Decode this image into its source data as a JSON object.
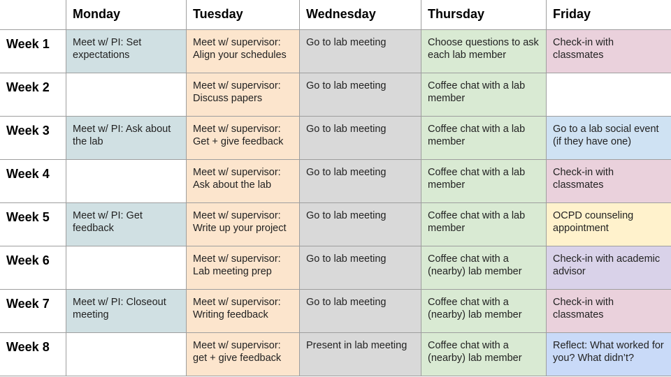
{
  "header": {
    "corner": "",
    "days": [
      "Monday",
      "Tuesday",
      "Wednesday",
      "Thursday",
      "Friday"
    ]
  },
  "colors": {
    "pi": "#d0e0e3",
    "supervisor": "#fce5cd",
    "lab_meeting": "#d9d9d9",
    "coffee": "#d9ead3",
    "classmates": "#ead1dc",
    "social": "#cfe2f3",
    "ocpd": "#fff2cc",
    "advisor": "#d9d2e9",
    "reflect": "#c9daf8"
  },
  "weeks": [
    {
      "label": "Week 1",
      "cells": [
        {
          "text": "Meet w/ PI: Set expectations",
          "cat": "pi"
        },
        {
          "text": "Meet w/ supervisor: Align your schedules",
          "cat": "sup"
        },
        {
          "text": "Go to lab meeting",
          "cat": "lab"
        },
        {
          "text": "Choose questions to ask each lab member",
          "cat": "coffee"
        },
        {
          "text": "Check-in with classmates",
          "cat": "class"
        }
      ]
    },
    {
      "label": "Week 2",
      "cells": [
        {
          "text": "",
          "cat": "empty"
        },
        {
          "text": "Meet w/ supervisor: Discuss papers",
          "cat": "sup"
        },
        {
          "text": "Go to lab meeting",
          "cat": "lab"
        },
        {
          "text": "Coffee chat with a lab member",
          "cat": "coffee"
        },
        {
          "text": "",
          "cat": "empty"
        }
      ]
    },
    {
      "label": "Week 3",
      "cells": [
        {
          "text": "Meet w/ PI: Ask about the lab",
          "cat": "pi"
        },
        {
          "text": "Meet w/ supervisor: Get + give feedback",
          "cat": "sup"
        },
        {
          "text": "Go to lab meeting",
          "cat": "lab"
        },
        {
          "text": "Coffee chat with a lab member",
          "cat": "coffee"
        },
        {
          "text": "Go to a lab social event (if they have one)",
          "cat": "social"
        }
      ]
    },
    {
      "label": "Week 4",
      "cells": [
        {
          "text": "",
          "cat": "empty"
        },
        {
          "text": "Meet w/ supervisor: Ask about the lab",
          "cat": "sup"
        },
        {
          "text": "Go to lab meeting",
          "cat": "lab"
        },
        {
          "text": "Coffee chat with a lab member",
          "cat": "coffee"
        },
        {
          "text": "Check-in with classmates",
          "cat": "class"
        }
      ]
    },
    {
      "label": "Week 5",
      "cells": [
        {
          "text": "Meet w/ PI: Get feedback",
          "cat": "pi"
        },
        {
          "text": "Meet w/ supervisor: Write up your project",
          "cat": "sup"
        },
        {
          "text": "Go to lab meeting",
          "cat": "lab"
        },
        {
          "text": "Coffee chat with a lab member",
          "cat": "coffee"
        },
        {
          "text": "OCPD counseling appointment",
          "cat": "ocpd"
        }
      ]
    },
    {
      "label": "Week 6",
      "cells": [
        {
          "text": "",
          "cat": "empty"
        },
        {
          "text": "Meet w/ supervisor: Lab meeting prep",
          "cat": "sup"
        },
        {
          "text": "Go to lab meeting",
          "cat": "lab"
        },
        {
          "text": "Coffee chat with a (nearby) lab member",
          "cat": "coffee"
        },
        {
          "text": "Check-in with academic advisor",
          "cat": "advisor"
        }
      ]
    },
    {
      "label": "Week 7",
      "cells": [
        {
          "text": "Meet w/ PI: Closeout meeting",
          "cat": "pi"
        },
        {
          "text": "Meet w/ supervisor: Writing feedback",
          "cat": "sup"
        },
        {
          "text": "Go to lab meeting",
          "cat": "lab"
        },
        {
          "text": "Coffee chat with a (nearby) lab member",
          "cat": "coffee"
        },
        {
          "text": "Check-in with classmates",
          "cat": "class"
        }
      ]
    },
    {
      "label": "Week 8",
      "cells": [
        {
          "text": "",
          "cat": "empty"
        },
        {
          "text": "Meet w/ supervisor: get + give feedback",
          "cat": "sup"
        },
        {
          "text": "Present in lab meeting",
          "cat": "lab"
        },
        {
          "text": "Coffee chat with a (nearby) lab member",
          "cat": "coffee"
        },
        {
          "text": "Reflect: What worked for you? What didn’t?",
          "cat": "reflect"
        }
      ]
    }
  ]
}
